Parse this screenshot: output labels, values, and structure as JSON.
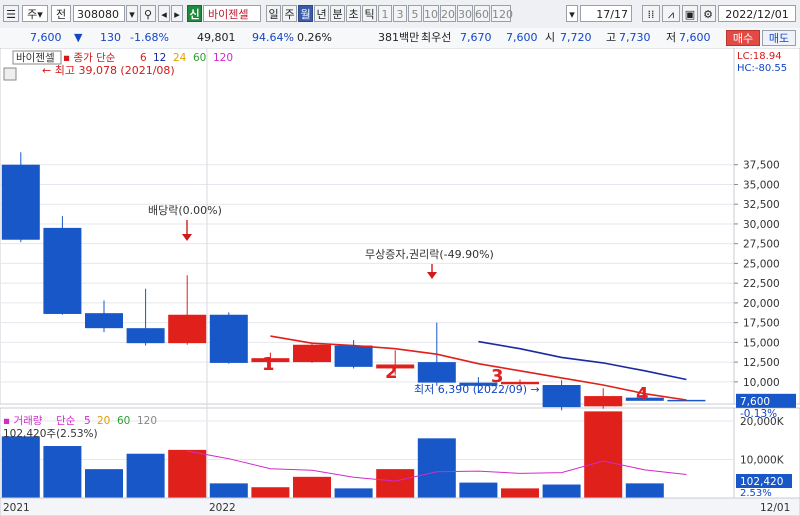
{
  "toolbar": {
    "market_label": "주",
    "type_label": "전",
    "code": "308080",
    "logo": "신",
    "name": "바이젠셀",
    "periods": [
      "일",
      "주",
      "월",
      "년",
      "분",
      "초",
      "틱"
    ],
    "active_period": "월",
    "counts": [
      "1",
      "3",
      "5",
      "10",
      "20",
      "30",
      "60",
      "120"
    ],
    "page_indicator": "17/17",
    "date": "2022/12/01"
  },
  "quote": {
    "price": "7,600",
    "direction": "▼",
    "change": "130",
    "change_pct": "-1.68%",
    "volume": "49,801",
    "ratio_pct": "94.64%",
    "turnover_pct": "0.26%",
    "amount": "381백만",
    "best_ask_label": "최우선",
    "best_ask": "7,670",
    "best_bid": "7,600",
    "open_label": "시",
    "open": "7,720",
    "high_label": "고",
    "high": "7,730",
    "low_label": "저",
    "low": "7,600",
    "buy_label": "매수",
    "sell_label": "매도"
  },
  "legend": {
    "name_tag": "바이젠셀",
    "ma_prefix": "종가 단순",
    "ma_periods": [
      "6",
      "12",
      "24",
      "60",
      "120"
    ],
    "volume_name": "거래량",
    "volume_ma_prefix": "단순",
    "volume_ma_periods": [
      "5",
      "20",
      "60",
      "120"
    ]
  },
  "indicators": {
    "lc": "LC:18.94",
    "hc": "HC:-80.55"
  },
  "colors": {
    "up": "#e0201b",
    "down": "#1757c8",
    "ma6": "#e0201b",
    "ma12": "#1a2aa0",
    "vol_ma": "#d12bc9",
    "grid": "#e4e7ee"
  },
  "chart_data": [
    {
      "type": "candlestick",
      "title": "",
      "xlabel": "",
      "ylabel": "",
      "x_tick_labels": [
        "2021",
        "2022"
      ],
      "y_tick_labels": [
        "37,500",
        "35,000",
        "32,500",
        "30,000",
        "27,500",
        "25,000",
        "22,500",
        "20,000",
        "17,500",
        "15,000",
        "12,500",
        "10,000"
      ],
      "ylim": [
        5000,
        40000
      ],
      "grid": true,
      "candles": [
        {
          "open": 37500,
          "high": 39078,
          "low": 27700,
          "close": 28000
        },
        {
          "open": 29500,
          "high": 31000,
          "low": 18500,
          "close": 18600
        },
        {
          "open": 18700,
          "high": 20300,
          "low": 16300,
          "close": 16800
        },
        {
          "open": 16800,
          "high": 21800,
          "low": 14600,
          "close": 14900
        },
        {
          "open": 14900,
          "high": 23500,
          "low": 14700,
          "close": 18500
        },
        {
          "open": 18500,
          "high": 18800,
          "low": 12300,
          "close": 12400
        },
        {
          "open": 12500,
          "high": 13700,
          "low": 11500,
          "close": 13000
        },
        {
          "open": 12500,
          "high": 14800,
          "low": 12400,
          "close": 14700
        },
        {
          "open": 14600,
          "high": 15300,
          "low": 11700,
          "close": 11900
        },
        {
          "open": 11700,
          "high": 14000,
          "low": 10900,
          "close": 12200
        },
        {
          "open": 12500,
          "high": 17500,
          "low": 9500,
          "close": 9900
        },
        {
          "open": 9900,
          "high": 10600,
          "low": 8600,
          "close": 9500
        },
        {
          "open": 9700,
          "high": 10300,
          "low": 9500,
          "close": 10000
        },
        {
          "open": 9600,
          "high": 10200,
          "low": 6390,
          "close": 6800
        },
        {
          "open": 6900,
          "high": 9200,
          "low": 6600,
          "close": 8200
        },
        {
          "open": 8000,
          "high": 8400,
          "low": 7600,
          "close": 7600
        },
        {
          "open": 7720,
          "high": 7730,
          "low": 7600,
          "close": 7600
        }
      ],
      "series": [
        {
          "name": "6",
          "values": [
            null,
            null,
            null,
            null,
            null,
            null,
            15800,
            14900,
            14600,
            14200,
            13500,
            12300,
            11400,
            10500,
            9600,
            8500,
            7700
          ]
        },
        {
          "name": "12",
          "values": [
            null,
            null,
            null,
            null,
            null,
            null,
            null,
            null,
            null,
            null,
            null,
            15100,
            14200,
            13100,
            12400,
            11400,
            10300
          ]
        }
      ],
      "annotations": {
        "high": "최고 39,078 (2021/08)",
        "low": "최저 6,390 (2022/09)",
        "dividend": "배당락(0.00%)",
        "rights": "무상증자,권리락(-49.90%)",
        "numbers": [
          "1",
          "2",
          "3",
          "4"
        ],
        "last_price": "7,600",
        "last_pct": "-0.13%"
      }
    },
    {
      "type": "bar",
      "title": "",
      "name": "거래량",
      "last_label": "102,420주(2.53%)",
      "y_tick_labels": [
        "20,000K",
        "10,000K"
      ],
      "ylim": [
        0,
        26000000
      ],
      "values": [
        16000000,
        13500000,
        7500000,
        11500000,
        12500000,
        3800000,
        2800000,
        5500000,
        2500000,
        7500000,
        15500000,
        4000000,
        2500000,
        3500000,
        22500000,
        3800000,
        102420
      ],
      "series": [
        {
          "name": "5",
          "values": [
            null,
            null,
            null,
            null,
            12200000,
            10200000,
            7600000,
            7200000,
            5400000,
            4400000,
            6800000,
            7000000,
            6400000,
            6600000,
            9600000,
            7300000,
            6100000
          ]
        }
      ],
      "x_tick_labels": [
        "2021",
        "2022",
        "12/01"
      ],
      "last_value_label": "102,420",
      "last_pct": "2.53%"
    }
  ]
}
